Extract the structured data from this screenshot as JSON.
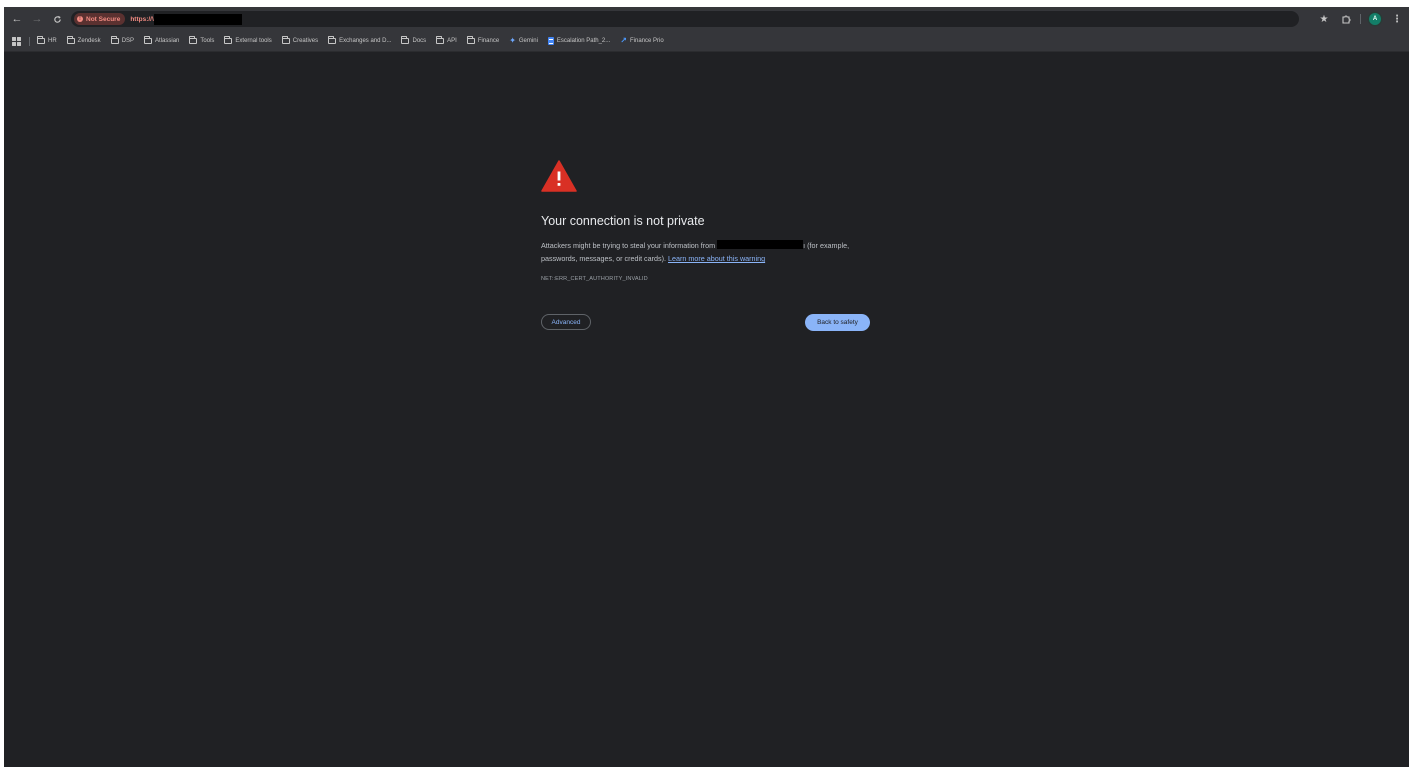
{
  "browser": {
    "nav": {
      "back_icon": "arrow-left-icon",
      "forward_icon": "arrow-right-icon",
      "reload_icon": "reload-icon"
    },
    "omnibox": {
      "security_label": "Not Secure",
      "url_prefix": "https://\\"
    },
    "toolbar": {
      "bookmark_star_icon": "star-icon",
      "extensions_icon": "puzzle-icon",
      "profile_initial": "A",
      "menu_icon": "more-vert-icon"
    }
  },
  "bookmarks": [
    {
      "label": "HR",
      "icon": "folder-icon"
    },
    {
      "label": "Zendesk",
      "icon": "folder-icon"
    },
    {
      "label": "DSP",
      "icon": "folder-icon"
    },
    {
      "label": "Atlassian",
      "icon": "folder-icon"
    },
    {
      "label": "Tools",
      "icon": "folder-icon"
    },
    {
      "label": "External tools",
      "icon": "folder-icon"
    },
    {
      "label": "Creatives",
      "icon": "folder-icon"
    },
    {
      "label": "Exchanges and D...",
      "icon": "folder-icon"
    },
    {
      "label": "Docs",
      "icon": "folder-icon"
    },
    {
      "label": "API",
      "icon": "folder-icon"
    },
    {
      "label": "Finance",
      "icon": "folder-icon"
    },
    {
      "label": "Gemini",
      "icon": "gemini-icon"
    },
    {
      "label": "Escalation Path_2...",
      "icon": "google-docs-icon"
    },
    {
      "label": "Finance Prio",
      "icon": "jira-icon"
    }
  ],
  "interstitial": {
    "heading": "Your connection is not private",
    "body_prefix": "Attackers might be trying to steal your information from ",
    "body_host_tail": "ı",
    "body_suffix": " (for example, passwords, messages, or credit cards). ",
    "learn_more": "Learn more about this warning",
    "error_code": "NET::ERR_CERT_AUTHORITY_INVALID",
    "advanced_button": "Advanced",
    "back_button": "Back to safety"
  },
  "colors": {
    "page_background": "#202124",
    "toolbar_background": "#35363a",
    "warning_red": "#d93025",
    "link_blue": "#8ab4f8",
    "not_secure_red": "#f28b82"
  }
}
